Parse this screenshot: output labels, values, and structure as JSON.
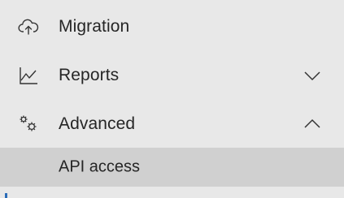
{
  "nav": {
    "items": [
      {
        "label": "Migration",
        "icon": "cloud-upload-icon",
        "has_chevron": false
      },
      {
        "label": "Reports",
        "icon": "line-chart-icon",
        "chevron": "chevron-down-icon",
        "expanded": false
      },
      {
        "label": "Advanced",
        "icon": "gears-icon",
        "chevron": "chevron-up-icon",
        "expanded": true,
        "children": [
          {
            "label": "API access",
            "selected": true
          }
        ]
      }
    ]
  },
  "colors": {
    "background": "#e8e8e8",
    "selected_background": "#d0d0d0",
    "text": "#262626",
    "accent": "#2b6cb8"
  }
}
